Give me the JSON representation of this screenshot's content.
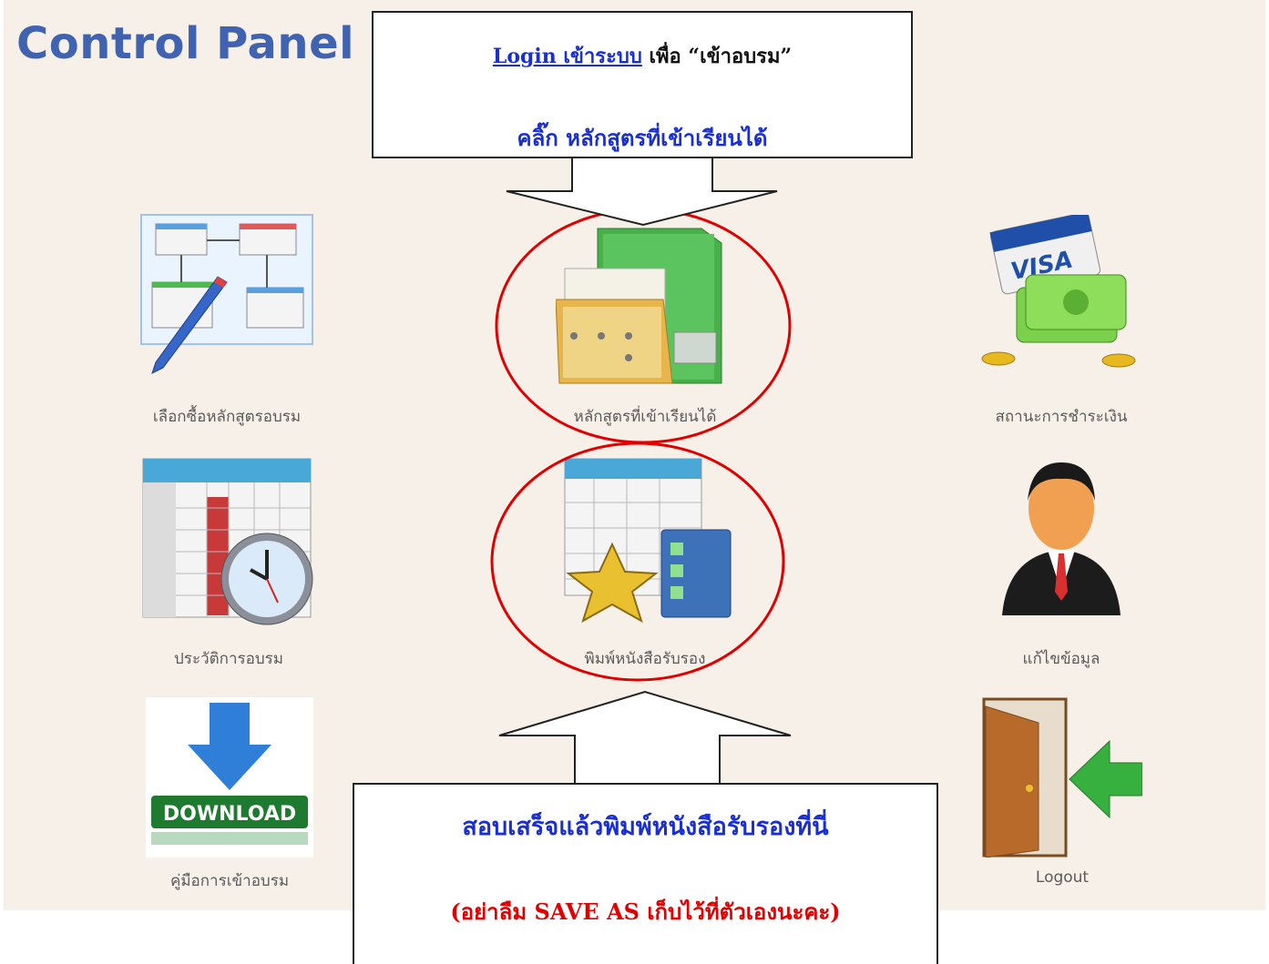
{
  "panel": {
    "title": "Control Panel"
  },
  "menu": {
    "buy_courses": "เลือกซื้อหลักสูตรอบรม",
    "available_courses": "หลักสูตรที่เข้าเรียนได้",
    "payment_status": "สถานะการชำระเงิน",
    "training_history": "ประวัติการอบรม",
    "print_certificate": "พิมพ์หนังสือรับรอง",
    "edit_profile": "แก้ไขข้อมูล",
    "training_manual": "คู่มือการเข้าอบรม",
    "logout": "Logout"
  },
  "icons": {
    "download_text": "DOWNLOAD",
    "visa_text": "VISA"
  },
  "callout_top": {
    "login_link": "Login เข้าระบบ",
    "line1_rest": "เพื่อ “เข้าอบรม”",
    "line2": "คลิ๊ก   หลักสูตรที่เข้าเรียนได้"
  },
  "callout_bottom": {
    "line1": "สอบเสร็จแล้วพิมพ์หนังสือรับรองที่นี่",
    "line2": "(อย่าลืม SAVE AS เก็บไว้ที่ตัวเองนะคะ)"
  },
  "colors": {
    "title_blue": "#3f63b0",
    "callout_blue": "#1a2fd0",
    "callout_red": "#e00000",
    "circle_red": "#e00000",
    "panel_bg": "#f6f0e8"
  }
}
